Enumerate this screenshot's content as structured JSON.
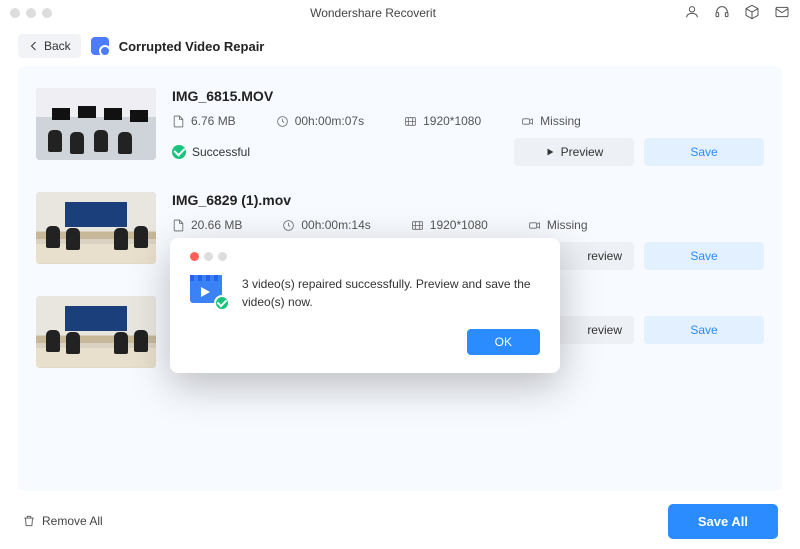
{
  "titlebar": {
    "app_name": "Wondershare Recoverit"
  },
  "header": {
    "back_label": "Back",
    "page_title": "Corrupted Video Repair"
  },
  "meta_labels": {
    "missing": "Missing"
  },
  "status_labels": {
    "successful": "Successful"
  },
  "buttons": {
    "preview": "Preview",
    "save": "Save",
    "remove_all": "Remove All",
    "save_all": "Save All",
    "ok": "OK"
  },
  "files": [
    {
      "name": "IMG_6815.MOV",
      "size": "6.76 MB",
      "duration": "00h:00m:07s",
      "resolution": "1920*1080"
    },
    {
      "name": "IMG_6829 (1).mov",
      "size": "20.66 MB",
      "duration": "00h:00m:14s",
      "resolution": "1920*1080"
    },
    {
      "name": "",
      "size": "",
      "duration": "",
      "resolution": ""
    }
  ],
  "modal": {
    "message": "3 video(s) repaired successfully. Preview and save the video(s) now."
  }
}
